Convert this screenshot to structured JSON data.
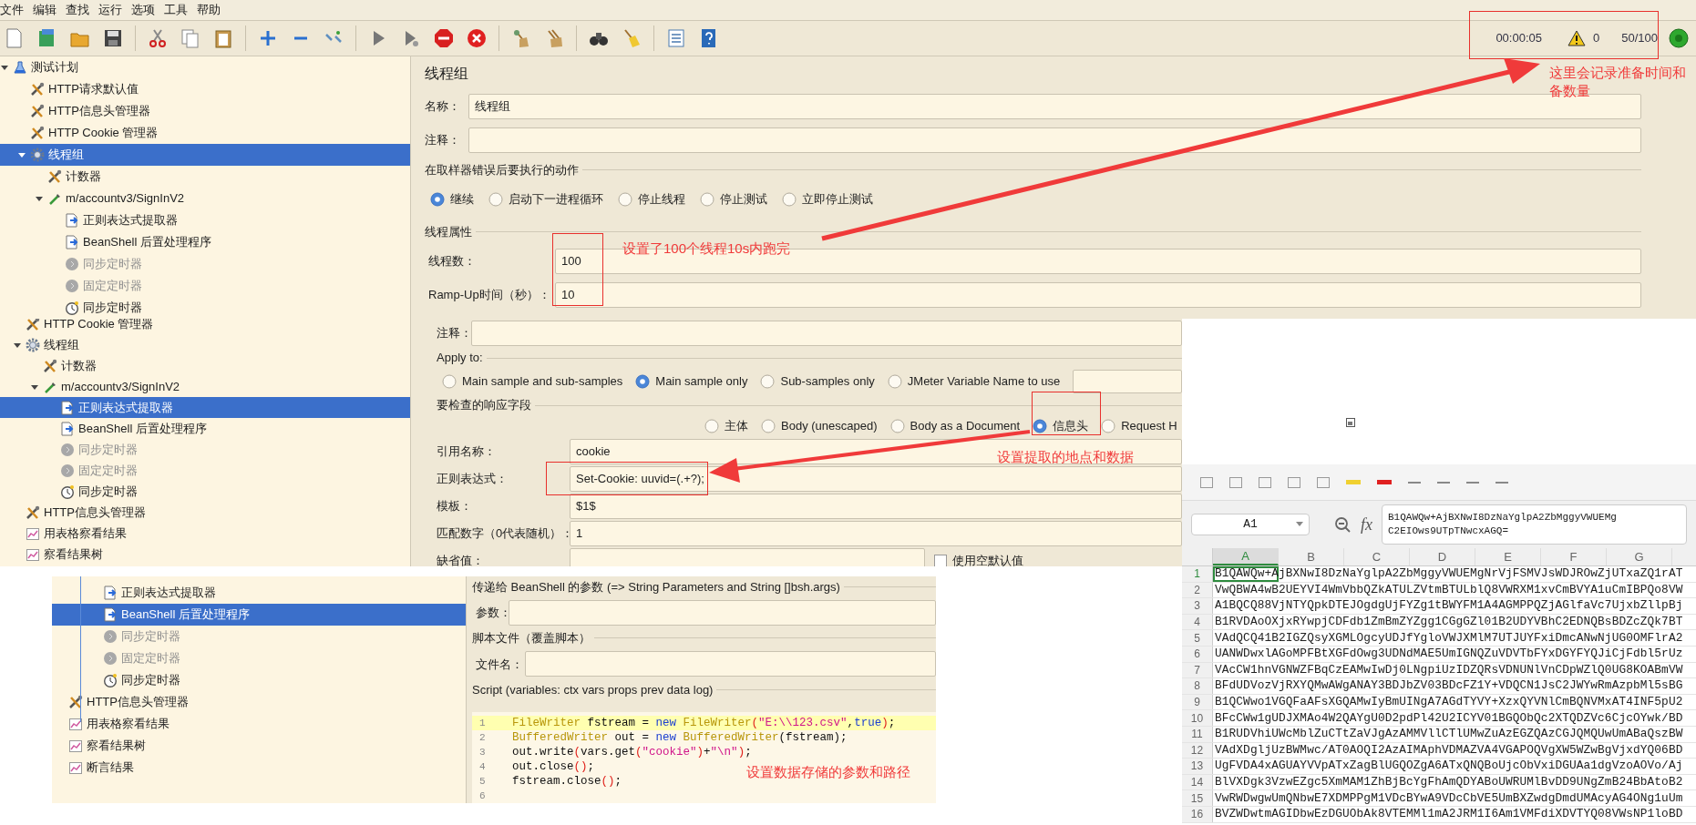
{
  "thread_group_view": {
    "menu": [
      "文件",
      "编辑",
      "查找",
      "运行",
      "选项",
      "工具",
      "帮助"
    ],
    "status": {
      "elapsed": "00:00:05",
      "warnings": "0",
      "threads": "50/100"
    },
    "tree": [
      {
        "label": "测试计划",
        "kind": "plan",
        "expanded": true,
        "selected": false,
        "disabled": false,
        "children": [
          {
            "label": "HTTP请求默认值",
            "kind": "config",
            "selected": false,
            "disabled": false
          },
          {
            "label": "HTTP信息头管理器",
            "kind": "config",
            "selected": false,
            "disabled": false
          },
          {
            "label": "HTTP Cookie 管理器",
            "kind": "config",
            "selected": false,
            "disabled": false
          },
          {
            "label": "线程组",
            "kind": "threadgroup",
            "expanded": true,
            "selected": true,
            "disabled": false,
            "children": [
              {
                "label": "计数器",
                "kind": "config",
                "selected": false,
                "disabled": false
              },
              {
                "label": "m/accountv3/SignInV2",
                "kind": "sampler",
                "expanded": true,
                "selected": false,
                "disabled": false,
                "children": [
                  {
                    "label": "正则表达式提取器",
                    "kind": "postprocessor",
                    "selected": false,
                    "disabled": false
                  },
                  {
                    "label": "BeanShell 后置处理程序",
                    "kind": "postprocessor",
                    "selected": false,
                    "disabled": false
                  },
                  {
                    "label": "同步定时器",
                    "kind": "timer",
                    "selected": false,
                    "disabled": true
                  },
                  {
                    "label": "固定定时器",
                    "kind": "timer",
                    "selected": false,
                    "disabled": true
                  },
                  {
                    "label": "同步定时器",
                    "kind": "timer",
                    "selected": false,
                    "disabled": false
                  }
                ]
              }
            ]
          }
        ]
      }
    ],
    "form": {
      "title": "线程组",
      "name_label": "名称：",
      "name": "线程组",
      "comment_label": "注释：",
      "error_action": {
        "title": "在取样器错误后要执行的动作",
        "options": [
          {
            "label": "继续",
            "selected": true
          },
          {
            "label": "启动下一进程循环",
            "selected": false
          },
          {
            "label": "停止线程",
            "selected": false
          },
          {
            "label": "停止测试",
            "selected": false
          },
          {
            "label": "立即停止测试",
            "selected": false
          }
        ]
      },
      "properties": {
        "title": "线程属性",
        "fields": [
          {
            "label": "线程数：",
            "value": "100"
          },
          {
            "label": "Ramp-Up时间（秒）：",
            "value": "10"
          }
        ]
      }
    }
  },
  "regex_extractor_view": {
    "tree": [
      {
        "label": "HTTP Cookie 管理器",
        "kind": "config",
        "selected": false,
        "disabled": false
      },
      {
        "label": "线程组",
        "kind": "threadgroup",
        "expanded": true,
        "selected": false,
        "disabled": false,
        "children": [
          {
            "label": "计数器",
            "kind": "config",
            "selected": false,
            "disabled": false
          },
          {
            "label": "m/accountv3/SignInV2",
            "kind": "sampler",
            "expanded": true,
            "selected": false,
            "disabled": false,
            "children": [
              {
                "label": "正则表达式提取器",
                "kind": "postprocessor",
                "selected": true,
                "disabled": false
              },
              {
                "label": "BeanShell 后置处理程序",
                "kind": "postprocessor",
                "selected": false,
                "disabled": false
              },
              {
                "label": "同步定时器",
                "kind": "timer",
                "selected": false,
                "disabled": true
              },
              {
                "label": "固定定时器",
                "kind": "timer",
                "selected": false,
                "disabled": true
              },
              {
                "label": "同步定时器",
                "kind": "timer",
                "selected": false,
                "disabled": false
              }
            ]
          }
        ]
      },
      {
        "label": "HTTP信息头管理器",
        "kind": "config",
        "selected": false,
        "disabled": false
      },
      {
        "label": "用表格察看结果",
        "kind": "listener",
        "selected": false,
        "disabled": false
      },
      {
        "label": "察看结果树",
        "kind": "listener",
        "selected": false,
        "disabled": false
      }
    ],
    "form": {
      "comment_label": "注释：",
      "apply_to": {
        "title": "Apply to:",
        "options": [
          {
            "label": "Main sample and sub-samples",
            "selected": false
          },
          {
            "label": "Main sample only",
            "selected": true
          },
          {
            "label": "Sub-samples only",
            "selected": false
          },
          {
            "label": "JMeter Variable Name to use",
            "selected": false
          }
        ]
      },
      "response_field": {
        "title": "要检查的响应字段",
        "options": [
          {
            "label": "主体",
            "selected": false
          },
          {
            "label": "Body (unescaped)",
            "selected": false
          },
          {
            "label": "Body as a Document",
            "selected": false
          },
          {
            "label": "信息头",
            "selected": true
          },
          {
            "label": "Request H",
            "selected": false
          }
        ]
      },
      "fields": [
        {
          "label": "引用名称：",
          "value": "cookie"
        },
        {
          "label": "正则表达式：",
          "value": "Set-Cookie: uuvid=(.+?);"
        },
        {
          "label": "模板：",
          "value": "$1$"
        },
        {
          "label": "匹配数字（0代表随机）：",
          "value": "1"
        },
        {
          "label": "缺省值："
        }
      ],
      "checkbox": {
        "label": "使用空默认值",
        "checked": false
      }
    }
  },
  "beanshell_view": {
    "tree": [
      {
        "children": [
          {
            "children": [
              {
                "label": "正则表达式提取器",
                "kind": "postprocessor",
                "selected": false,
                "disabled": false
              },
              {
                "label": "BeanShell 后置处理程序",
                "kind": "postprocessor",
                "selected": true,
                "disabled": false
              },
              {
                "label": "同步定时器",
                "kind": "timer",
                "selected": false,
                "disabled": true
              },
              {
                "label": "固定定时器",
                "kind": "timer",
                "selected": false,
                "disabled": true
              },
              {
                "label": "同步定时器",
                "kind": "timer",
                "selected": false,
                "disabled": false
              }
            ]
          }
        ]
      },
      {
        "label": "HTTP信息头管理器",
        "kind": "config",
        "selected": false,
        "disabled": false
      },
      {
        "label": "用表格察看结果",
        "kind": "listener",
        "selected": false,
        "disabled": false
      },
      {
        "label": "察看结果树",
        "kind": "listener",
        "selected": false,
        "disabled": false
      },
      {
        "label": "断言结果",
        "kind": "listener",
        "selected": false,
        "disabled": false
      }
    ],
    "form": {
      "params": {
        "title": "传递给 BeanShell 的参数 (=> String Parameters and String []bsh.args)",
        "label": "参数："
      },
      "script_file": {
        "title": "脚本文件（覆盖脚本）",
        "label": "文件名："
      },
      "script": {
        "title": "Script (variables: ctx vars props prev data log)",
        "lines": [
          {
            "number": "1",
            "highlighted": true,
            "tokens": [
              {
                "kind": "type",
                "text": "FileWriter"
              },
              {
                "kind": "plain",
                "text": " fstream = "
              },
              {
                "kind": "keyword",
                "text": "new"
              },
              {
                "kind": "type",
                "text": " FileWriter"
              },
              {
                "kind": "paren",
                "text": "("
              },
              {
                "kind": "string",
                "text": "\"E:\\\\123.csv\""
              },
              {
                "kind": "plain",
                "text": ","
              },
              {
                "kind": "keyword",
                "text": "true"
              },
              {
                "kind": "paren",
                "text": ")"
              },
              {
                "kind": "plain",
                "text": ";"
              }
            ]
          },
          {
            "number": "2",
            "highlighted": false,
            "tokens": [
              {
                "kind": "type",
                "text": "BufferedWriter"
              },
              {
                "kind": "plain",
                "text": " out = "
              },
              {
                "kind": "keyword",
                "text": "new"
              },
              {
                "kind": "type",
                "text": " BufferedWriter"
              },
              {
                "kind": "plain",
                "text": "(fstream);"
              }
            ]
          },
          {
            "number": "3",
            "highlighted": false,
            "tokens": [
              {
                "kind": "plain",
                "text": "out.write"
              },
              {
                "kind": "paren",
                "text": "("
              },
              {
                "kind": "plain",
                "text": "vars.get"
              },
              {
                "kind": "paren",
                "text": "("
              },
              {
                "kind": "string",
                "text": "\"cookie\""
              },
              {
                "kind": "paren",
                "text": ")"
              },
              {
                "kind": "plain",
                "text": "+"
              },
              {
                "kind": "string",
                "text": "\"\\n\""
              },
              {
                "kind": "paren",
                "text": ")"
              },
              {
                "kind": "plain",
                "text": ";"
              }
            ]
          },
          {
            "number": "4",
            "highlighted": false,
            "tokens": [
              {
                "kind": "plain",
                "text": "out.close"
              },
              {
                "kind": "paren",
                "text": "()"
              },
              {
                "kind": "plain",
                "text": ";"
              }
            ]
          },
          {
            "number": "5",
            "highlighted": false,
            "tokens": [
              {
                "kind": "plain",
                "text": "fstream.close"
              },
              {
                "kind": "paren",
                "text": "()"
              },
              {
                "kind": "plain",
                "text": ";"
              }
            ]
          },
          {
            "number": "6",
            "highlighted": false
          }
        ]
      }
    }
  },
  "spreadsheet": {
    "name_box": "A1",
    "fx": "fx",
    "formula_lines": [
      "B1QAWQw+AjBXNwI8DzNaYglpA2ZbMggyVWUEMg",
      "C2EIOws9UTpTNwcxAGQ="
    ],
    "columns": [
      {
        "label": "A",
        "selected": true
      },
      {
        "label": "B",
        "selected": false
      },
      {
        "label": "C",
        "selected": false
      },
      {
        "label": "D",
        "selected": false
      },
      {
        "label": "E",
        "selected": false
      },
      {
        "label": "F",
        "selected": false
      },
      {
        "label": "G",
        "selected": false
      }
    ],
    "rows": [
      {
        "number": "1",
        "value": "B1QAWQw+AjBXNwI8DzNaYglpA2ZbMggyVWUEMgNrVjFSMVJsWDJROwZjUTxaZQ1rAT",
        "selected": true
      },
      {
        "number": "2",
        "value": "VwQBWA4wB2UEYVI4WmVbbQZkATULZVtmBTULblQ8VWRXM1xvCmBVYA1uCmIBPQo8VW",
        "selected": false
      },
      {
        "number": "3",
        "value": "A1BQCQ88VjNTYQpkDTEJOgdgUjFYZg1tBWYFM1A4AGMPPQZjAGlfaVc7UjxbZllpBj",
        "selected": false
      },
      {
        "number": "4",
        "value": "B1RVDAoOXjxRYwpjCDFdb1ZmBmZYZgg1CGgGZl01B2UDYVBhC2EDNQBsBDZcZQk7BT",
        "selected": false
      },
      {
        "number": "5",
        "value": "VAdQCQ41B2IGZQsyXGMLOgcyUDJfYgloVWJXMlM7UTJUYFxiDmcANwNjUG0OMFlrA2",
        "selected": false
      },
      {
        "number": "6",
        "value": "UANWDwxlAGoMPFBtXGFdOwg3UDNdMAE5UmIGNQZuVDVTbFYxDGYFYQJiCjFdbl5rUz",
        "selected": false
      },
      {
        "number": "7",
        "value": "VAcCW1hnVGNWZFBqCzEAMwIwDj0LNgpiUzIDZQRsVDNUNlVnCDpWZlQ0UG8KOABmVW",
        "selected": false
      },
      {
        "number": "8",
        "value": "BFdUDVozVjRXYQMwAWgANAY3BDJbZV03BDcFZ1Y+VDQCN1JsC2JWYwRmAzpbMl5sBG",
        "selected": false
      },
      {
        "number": "9",
        "value": "B1QCWwo1VGQFaAFsXGQAMwIyBmUINgA7AGdTYVY+XzxQYVNlCmBQNVMxAT4INF5pU2",
        "selected": false
      },
      {
        "number": "10",
        "value": "BFcCWw1gUDJXMAo4W2QAYgU0D2pdPl42U2ICYV01BGQObQc2XTQDZVc6CjcOYwk/BD",
        "selected": false
      },
      {
        "number": "11",
        "value": "B1RUDVhiUWcMblZuCTtZaVJgAzAMMVllCTlUMwZuAzEGZQAzCGJQMQUwUmABaQszBW",
        "selected": false
      },
      {
        "number": "12",
        "value": "VAdXDgljUzBWMwc/AT0AOQI2AzAIMAphVDMAZVA4VGAPOQVgXW5WZwBgVjxdYQ06BD",
        "selected": false
      },
      {
        "number": "13",
        "value": "UgFVDA4xAGUAYVVpATxZagBlUGQOZgA6ATxQNQBoUjcObVxiDGUAa1dgVzoAOVo/Aj",
        "selected": false
      },
      {
        "number": "14",
        "value": "BlVXDgk3VzwEZgc5XmMAM1ZhBjBcYgFhAmQDYABoUWRUMlBvDD9UNgZmB24BbAtoB2",
        "selected": false
      },
      {
        "number": "15",
        "value": "VwRWDwgwUmQNbwE7XDMPPgM1VDcBYwA9VDcCbVE5UmBXZwdgDmdUMAcyAG4ONg1uUm",
        "selected": false
      },
      {
        "number": "16",
        "value": "BVZWDwtmAGIDbwEzDGUObAk8VTEMMl1mA2JRM1I6Am1VMFdiXDVTYQ08VWsNP1loBD",
        "selected": false
      }
    ]
  },
  "annotations": [
    {
      "lines": [
        "这里会记录准备时间和",
        "备数量"
      ]
    },
    {
      "lines": [
        "设置了100个线程10s内跑完"
      ]
    },
    {
      "lines": [
        "设置提取的地点和数据"
      ]
    },
    {
      "lines": [
        "设置数据存储的参数和路径"
      ]
    }
  ]
}
